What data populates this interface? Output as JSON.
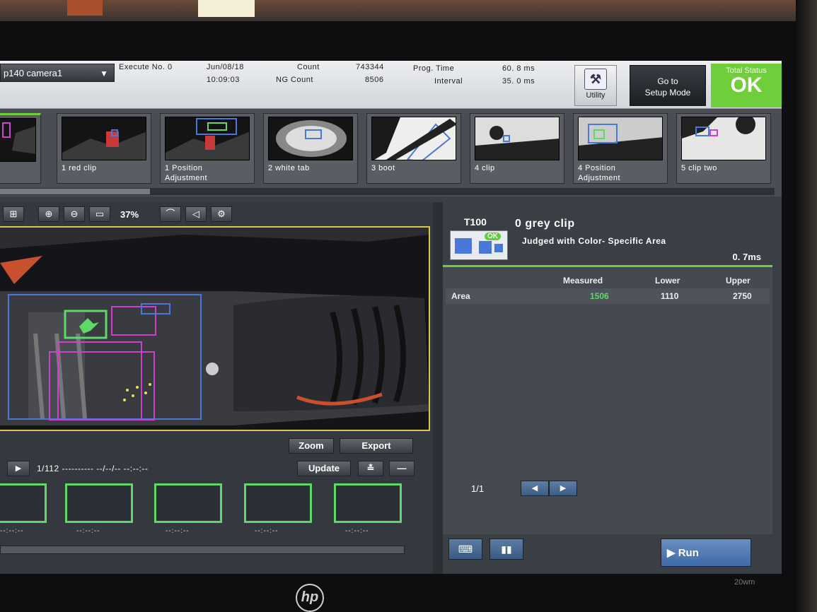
{
  "monitor": {
    "brand": "hp",
    "model": "20wm"
  },
  "header": {
    "camera_select": "p140  camera1",
    "execute_label": "Execute No. 0",
    "date": "Jun/08/18",
    "time": "10:09:03",
    "count_label": "Count",
    "count_value": "743344",
    "ng_count_label": "NG Count",
    "ng_count_value": "8506",
    "prog_time_label": "Prog.  Time",
    "prog_time_value": "60. 8  ms",
    "interval_label": "Interval",
    "interval_value": "35. 0  ms",
    "utility_label": "Utility",
    "setup_line1": "Go  to",
    "setup_line2": "Setup  Mode",
    "total_status_label": "Total  Status",
    "total_status_value": "OK",
    "status_color": "#6fcf3a"
  },
  "thumbnails": [
    {
      "line1": "on",
      "line2": "ent"
    },
    {
      "line1": "1  red  clip",
      "line2": ""
    },
    {
      "line1": "1  Position",
      "line2": "Adjustment"
    },
    {
      "line1": "2  white  tab",
      "line2": ""
    },
    {
      "line1": "3  boot",
      "line2": ""
    },
    {
      "line1": "4  clip",
      "line2": ""
    },
    {
      "line1": "4  Position",
      "line2": "Adjustment"
    },
    {
      "line1": "5  clip  two",
      "line2": ""
    }
  ],
  "viewer": {
    "zoom_percent": "37%",
    "zoom_button": "Zoom",
    "export_button": "Export",
    "frame_counter": "1/112  ----------  --/--/--  --:--:--",
    "update_button": "Update",
    "history_label": "--:--:--",
    "border_color": "#d8c84a"
  },
  "result": {
    "tool_id": "T100",
    "tool_badge": "OK",
    "title": "0  grey  clip",
    "subtitle": "Judged  with  Color- Specific  Area",
    "time": "0. 7ms",
    "columns": [
      "",
      "Measured",
      "Lower",
      "Upper"
    ],
    "rows": [
      {
        "name": "Area",
        "measured": "1506",
        "lower": "1110",
        "upper": "2750"
      }
    ],
    "measured_color": "#5fd86a",
    "pager": "1/1",
    "run_button": "Run"
  }
}
